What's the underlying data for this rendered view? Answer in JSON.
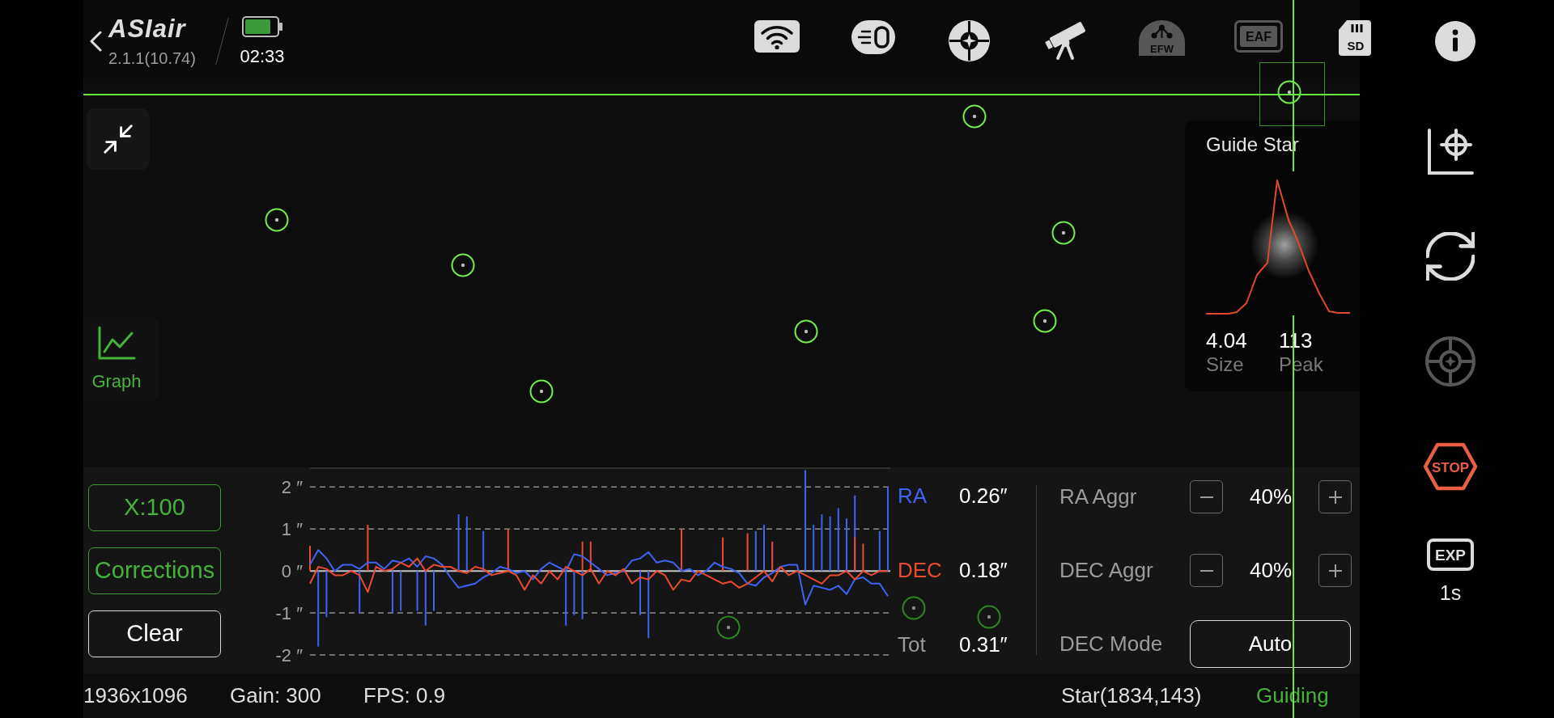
{
  "top_bar": {
    "logo": "ASIair",
    "version": "2.1.1(10.74)",
    "time": "02:33"
  },
  "devices": [
    {
      "kind": "wifi",
      "connected": true
    },
    {
      "kind": "camera",
      "connected": true
    },
    {
      "kind": "guide",
      "connected": true
    },
    {
      "kind": "mount",
      "connected": true
    },
    {
      "kind": "efw",
      "label": "EFW",
      "connected": false
    },
    {
      "kind": "eaf",
      "label": "EAF",
      "connected": false
    },
    {
      "kind": "sd",
      "label": "SD",
      "connected": true
    }
  ],
  "graph_toggle": {
    "label": "Graph",
    "active": true
  },
  "guide_star": {
    "title": "Guide Star",
    "stats": [
      {
        "value": "4.04",
        "label": "Size"
      },
      {
        "value": "113",
        "label": "Peak"
      }
    ]
  },
  "graph_buttons": [
    {
      "label": "X:100",
      "active": true
    },
    {
      "label": "Corrections",
      "active": true
    },
    {
      "label": "Clear",
      "active": false
    }
  ],
  "chart_data": {
    "type": "line",
    "grid": true,
    "ylim": [
      -2,
      2.45
    ],
    "yticks": [
      {
        "value": 2,
        "label": "2 ″"
      },
      {
        "value": 1,
        "label": "1 ″"
      },
      {
        "value": 0,
        "label": "0 ″"
      },
      {
        "value": -1,
        "label": "-1 ″"
      },
      {
        "value": -2,
        "label": "-2 ″"
      }
    ],
    "series": [
      {
        "name": "RA",
        "color": "#3d63f0",
        "values": [
          0.15,
          0.5,
          0.3,
          0.0,
          0.15,
          0.15,
          0.05,
          0.2,
          0.2,
          0.05,
          0.25,
          0.2,
          0.3,
          0.1,
          0.35,
          0.3,
          0.15,
          -0.15,
          -0.4,
          -0.35,
          -0.3,
          -0.15,
          -0.05,
          0.1,
          0.05,
          -0.05,
          0.0,
          -0.2,
          0.05,
          0.2,
          0.1,
          0.0,
          0.4,
          0.35,
          0.2,
          0.05,
          -0.1,
          -0.05,
          0.0,
          0.25,
          0.3,
          0.45,
          0.2,
          0.25,
          0.2,
          0.0,
          0.05,
          -0.1,
          0.0,
          0.2,
          0.1,
          0.05,
          -0.05,
          -0.3,
          -0.35,
          -0.15,
          -0.05,
          0.1,
          0.15,
          0.15,
          -0.8,
          -0.35,
          -0.4,
          -0.45,
          -0.35,
          -0.55,
          -0.2,
          -0.15,
          -0.3,
          -0.3,
          -0.6
        ]
      },
      {
        "name": "DEC",
        "color": "#ea4b2f",
        "values": [
          -0.3,
          0.1,
          0.05,
          -0.1,
          -0.1,
          0.0,
          -0.1,
          -0.5,
          0.1,
          0.0,
          0.05,
          0.2,
          0.1,
          0.3,
          0.0,
          0.15,
          0.1,
          0.1,
          0.0,
          -0.05,
          0.1,
          0.05,
          -0.1,
          -0.05,
          0.0,
          -0.1,
          -0.45,
          -0.1,
          -0.3,
          0.0,
          -0.2,
          0.1,
          0.0,
          -0.1,
          0.05,
          -0.3,
          0.0,
          -0.1,
          0.05,
          -0.3,
          -0.15,
          -0.2,
          0.0,
          -0.1,
          -0.45,
          -0.2,
          -0.25,
          0.0,
          -0.1,
          -0.2,
          -0.3,
          -0.25,
          -0.4,
          -0.3,
          -0.15,
          0.0,
          -0.25,
          0.1,
          -0.1,
          0.0,
          -0.1,
          -0.2,
          -0.3,
          -0.1,
          -0.1,
          0.0,
          -0.2,
          0.0,
          -0.1,
          0.0,
          0.0
        ]
      },
      {
        "type": "bar",
        "color": "#3d63f0",
        "values": [
          null,
          -1.8,
          -1.1,
          null,
          null,
          null,
          -1.0,
          null,
          null,
          null,
          -1.0,
          -0.95,
          null,
          -0.95,
          -1.3,
          -0.95,
          null,
          null,
          1.35,
          1.3,
          null,
          0.95,
          null,
          null,
          null,
          null,
          null,
          null,
          null,
          null,
          null,
          -1.3,
          -1.05,
          -1.15,
          null,
          null,
          null,
          null,
          null,
          null,
          -1.05,
          -1.6,
          null,
          null,
          null,
          null,
          null,
          null,
          null,
          null,
          null,
          null,
          null,
          null,
          0.95,
          1.1,
          null,
          null,
          null,
          null,
          2.4,
          1.1,
          1.35,
          1.3,
          1.5,
          1.25,
          1.8,
          null,
          null,
          0.95,
          2.0
        ]
      },
      {
        "type": "bar",
        "color": "#ea4b2f",
        "values": [
          0.6,
          null,
          null,
          null,
          null,
          null,
          null,
          1.1,
          null,
          null,
          null,
          null,
          null,
          null,
          null,
          null,
          null,
          null,
          null,
          null,
          null,
          null,
          null,
          null,
          1.0,
          null,
          null,
          null,
          null,
          null,
          null,
          null,
          null,
          0.7,
          0.7,
          null,
          null,
          null,
          null,
          null,
          null,
          null,
          null,
          null,
          null,
          1.0,
          null,
          null,
          null,
          null,
          0.8,
          null,
          null,
          0.9,
          null,
          null,
          0.7,
          null,
          null,
          null,
          null,
          null,
          null,
          null,
          null,
          null,
          0.8,
          0.65,
          null,
          null,
          null
        ]
      }
    ]
  },
  "legend": {
    "readings": [
      "0.26″",
      "0.18″"
    ],
    "total": {
      "name": "Tot",
      "reading": "0.31″"
    }
  },
  "aggressiveness": [
    {
      "label": "RA Aggr",
      "value": "40%"
    },
    {
      "label": "DEC Aggr",
      "value": "40%"
    }
  ],
  "dec_mode": {
    "label": "DEC Mode",
    "value": "Auto"
  },
  "status_bar": {
    "items": [
      "1936x1096",
      "Gain: 300",
      "FPS: 0.9"
    ],
    "star": "Star(1834,143)",
    "state": "Guiding"
  },
  "tools": [
    {
      "kind": "target_axes",
      "enabled": true
    },
    {
      "kind": "sync",
      "enabled": true
    },
    {
      "kind": "target",
      "enabled": false
    },
    {
      "kind": "stop",
      "label": "STOP",
      "enabled": true
    },
    {
      "kind": "exposure",
      "label": "EXP",
      "value": "1s",
      "enabled": true
    }
  ]
}
